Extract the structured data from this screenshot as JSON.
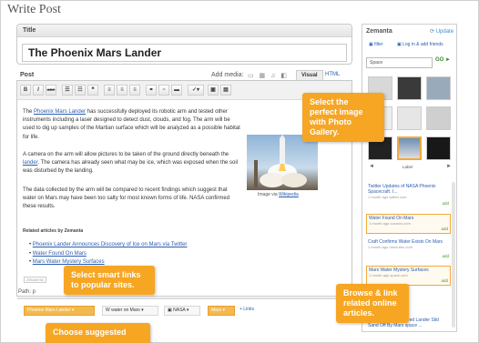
{
  "page_title": "Write Post",
  "title_box": {
    "label": "Title",
    "value": "The Phoenix Mars Lander"
  },
  "post_box": {
    "label": "Post",
    "add_media_label": "Add media:",
    "tabs": [
      "Visual",
      "HTML"
    ],
    "toolbar": [
      "B",
      "I",
      "ABC"
    ],
    "paragraphs": [
      {
        "pre": "The ",
        "link": "Phoenix Mars Lander",
        "post": " has successfully deployed its robotic arm and tested other instruments including a laser designed to detect dust, clouds, and fog. The arm will be used to dig up samples of the Martian surface which will be analyzed as a possible habitat for life."
      },
      {
        "pre": "A camera on the arm will allow pictures to be taken of the ground directly beneath the ",
        "link": "lander",
        "post": ". The camera has already seen what may be ice, which was exposed when the soil was disturbed by the landing."
      },
      {
        "pre": "The data collected by the arm will be compared to recent findings which suggest that water on Mars may have been too salty for most known forms of life. NASA confirmed these results.",
        "link": "",
        "post": ""
      }
    ],
    "image_caption_pre": "Image via ",
    "image_caption_link": "Wikipedia",
    "related_heading": "Related articles by Zemanta",
    "related_links": [
      "Phoenix Lander Announces Discovery of Ice on Mars via Twitter",
      "Water Found On Mars",
      "Mars Water Mystery Surfaces"
    ],
    "path_label": "Path: p",
    "badge": "ZEMANTA"
  },
  "tags": {
    "items": [
      "Phoenix Mars Lander",
      "water on Mars",
      "NASA",
      "Mars"
    ],
    "more": "+ Links"
  },
  "zemanta": {
    "brand": "Zemanta",
    "update": "Update",
    "filter": "filter",
    "login": "Log in & add friends",
    "search_placeholder": "Space",
    "go": "GO ►",
    "labels": [
      "Label"
    ],
    "articles": [
      {
        "title": "Twitter Updates of NASA Phoenix Spacecraft. I...",
        "meta": "1 month ago twitter.com",
        "add": "add"
      },
      {
        "title": "Water Found On Mars",
        "meta": "1 month ago cosmos.com",
        "add": "add"
      },
      {
        "title": "Craft Confirms Water Exists On Mars",
        "meta": "1 month ago news.bbc.com",
        "add": "add"
      },
      {
        "title": "Mars Water Mystery Surfaces",
        "meta": "1 month ago space.com",
        "add": "add"
      },
      {
        "title": "Martian Ice Discovered Lander Slid Sand Off By Mars space ...",
        "meta": "",
        "add": ""
      }
    ]
  },
  "callouts": {
    "photo": "Select the perfect image with Photo Gallery.",
    "links": "Select smart links to popular sites.",
    "related": "Browse & link related online articles.",
    "suggested": "Choose suggested"
  },
  "colors": {
    "accent": "#f6a623",
    "link": "#2a5db0"
  }
}
